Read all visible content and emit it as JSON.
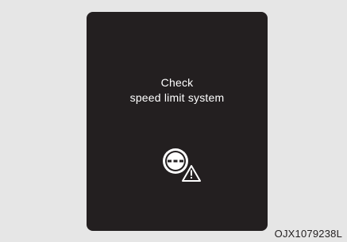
{
  "display": {
    "message_line1": "Check",
    "message_line2": "speed limit system",
    "icon": "speed-limit-warning-icon"
  },
  "caption": "OJX1079238L",
  "colors": {
    "background": "#e6e6e6",
    "panel": "#231f20",
    "text": "#ffffff"
  }
}
